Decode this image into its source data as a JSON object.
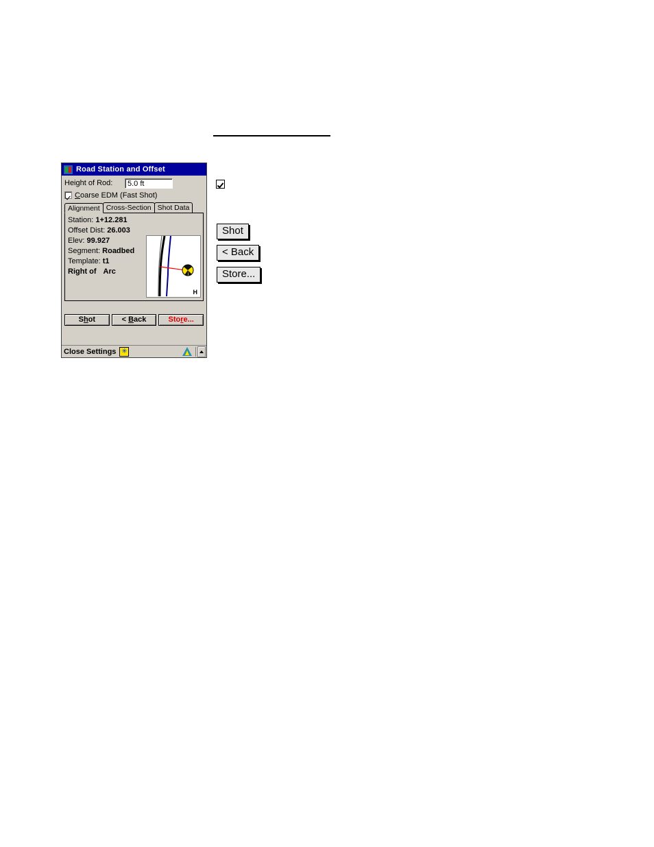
{
  "window": {
    "title": "Road Station and Offset",
    "title_icon": "road-signs-icon",
    "height_of_rod": {
      "label": "Height of Rod:",
      "value": "5.0 ft"
    },
    "coarse_edm": {
      "label_prefix": "C",
      "label_rest": "oarse EDM (Fast Shot)",
      "checked": true
    },
    "tabs": [
      {
        "label": "Alignment",
        "active": true
      },
      {
        "label": "Cross-Section",
        "active": false
      },
      {
        "label": "Shot Data",
        "active": false
      }
    ],
    "fields": [
      {
        "label": "Station:",
        "value": "1+12.281"
      },
      {
        "label": "Offset Dist:",
        "value": "26.003"
      },
      {
        "label": "Elev:",
        "value": "99.927"
      },
      {
        "label": "Segment:",
        "value": "Roadbed"
      },
      {
        "label": "Template:",
        "value": "t1"
      }
    ],
    "side_line": {
      "label": "Right of",
      "value": "Arc"
    },
    "map": {
      "corner_label": "H",
      "alignment_color": "#000000",
      "design_color": "#00008b",
      "offset_line_color": "#ff0000",
      "target_color": "#ffe400"
    },
    "buttons": [
      {
        "name": "shot",
        "prefix": "S",
        "mnemonic": "",
        "text": "Shot",
        "mnemonic_index": 1,
        "color": "#000000"
      },
      {
        "name": "back",
        "text": "< Back",
        "mnemonic_index": 3,
        "color": "#000000"
      },
      {
        "name": "store",
        "text": "Store...",
        "mnemonic_index": 3,
        "color": "#e00000"
      }
    ],
    "button_labels": {
      "shot_pre": "S",
      "shot_mn": "h",
      "shot_post": "ot",
      "back_pre": "< ",
      "back_mn": "B",
      "back_post": "ack",
      "store_pre": "Sto",
      "store_mn": "r",
      "store_post": "e..."
    },
    "statusbar": {
      "text": "Close Settings",
      "star_icon": "star-button-icon",
      "instrument_icon": "instrument-triangle-icon",
      "up_icon": "chevron-up-icon"
    }
  },
  "callouts": {
    "checkbox_glyph": "checked-checkbox-glyph",
    "shot_label": "Shot",
    "back_label": "< Back",
    "store_label": "Store..."
  }
}
